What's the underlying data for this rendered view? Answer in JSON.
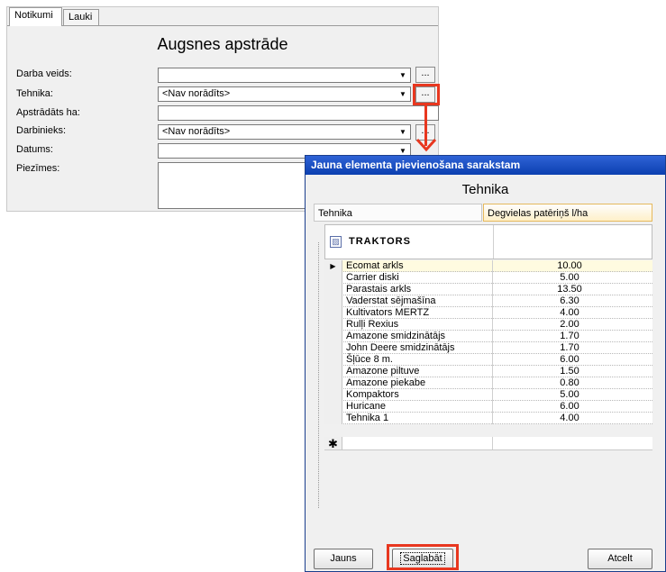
{
  "form": {
    "tabs": [
      "Notikumi",
      "Lauki"
    ],
    "title": "Augsnes apstrāde",
    "fields": {
      "darba_veids": {
        "label": "Darba veids:",
        "value": ""
      },
      "tehnika": {
        "label": "Tehnika:",
        "value": "<Nav norādīts>"
      },
      "apstradats": {
        "label": "Apstrādāts ha:",
        "value": ""
      },
      "darbinieks": {
        "label": "Darbinieks:",
        "value": "<Nav norādīts>"
      },
      "datums": {
        "label": "Datums:",
        "value": ""
      },
      "piezimes": {
        "label": "Piezīmes:",
        "value": ""
      }
    },
    "ellipsis": "..."
  },
  "dialog": {
    "title": "Jauna elementa pievienošana sarakstam",
    "heading": "Tehnika",
    "columns": [
      "Tehnika",
      "Degvielas patēriņš l/ha"
    ],
    "group": "TRAKTORS",
    "rows": [
      {
        "name": "Ecomat arkls",
        "value": "10.00"
      },
      {
        "name": "Carrier diski",
        "value": "5.00"
      },
      {
        "name": "Parastais arkls",
        "value": "13.50"
      },
      {
        "name": "Vaderstat sējmašīna",
        "value": "6.30"
      },
      {
        "name": "Kultivators MERTZ",
        "value": "4.00"
      },
      {
        "name": "Rulļi Rexius",
        "value": "2.00"
      },
      {
        "name": "Amazone smidzinātājs",
        "value": "1.70"
      },
      {
        "name": "John Deere smidzinātājs",
        "value": "1.70"
      },
      {
        "name": "Šļūce 8 m.",
        "value": "6.00"
      },
      {
        "name": "Amazone piltuve",
        "value": "1.50"
      },
      {
        "name": "Amazone piekabe",
        "value": "0.80"
      },
      {
        "name": "Kompaktors",
        "value": "5.00"
      },
      {
        "name": "Huricane",
        "value": "6.00"
      },
      {
        "name": "Tehnika 1",
        "value": "4.00"
      }
    ],
    "buttons": {
      "new": "Jauns",
      "save": "Saglabāt",
      "cancel": "Atcelt"
    }
  },
  "colors": {
    "highlight": "#e8371f",
    "titlebar": "#0b3fb0"
  }
}
